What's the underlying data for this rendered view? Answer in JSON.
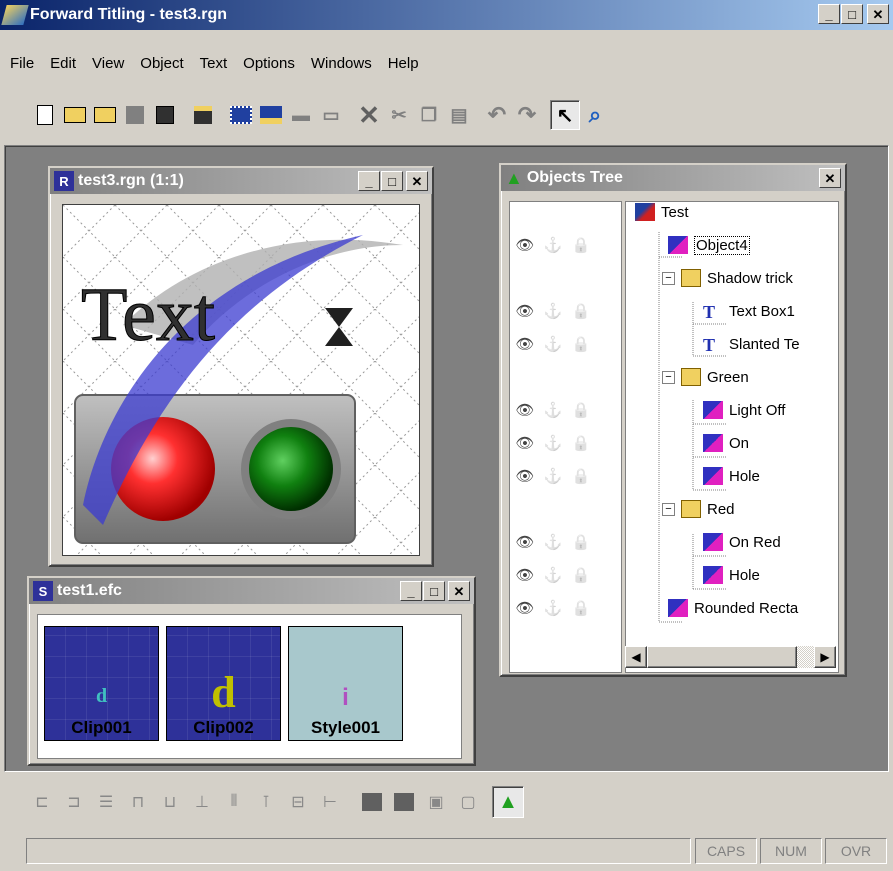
{
  "app": {
    "title": "Forward Titling - test3.rgn"
  },
  "caption_buttons": {
    "min": "_",
    "max": "□",
    "close": "✕"
  },
  "menu": [
    "File",
    "Edit",
    "View",
    "Object",
    "Text",
    "Options",
    "Windows",
    "Help"
  ],
  "doc_window": {
    "title": "test3.rgn  (1:1)",
    "canvas_text": "Text"
  },
  "clips_window": {
    "title": "test1.efc",
    "items": [
      {
        "glyph": "d",
        "label": "Clip001"
      },
      {
        "glyph": "d",
        "label": "Clip002"
      },
      {
        "glyph": "i",
        "label": "Style001"
      }
    ]
  },
  "tree_window": {
    "title": "Objects Tree",
    "items": [
      {
        "label": "Test",
        "depth": 0
      },
      {
        "label": "Object4",
        "depth": 1
      },
      {
        "label": "Shadow trick",
        "depth": 1,
        "expander": "−"
      },
      {
        "label": "Text Box1",
        "depth": 2
      },
      {
        "label": "Slanted Te",
        "depth": 2
      },
      {
        "label": "Green",
        "depth": 1,
        "expander": "−"
      },
      {
        "label": "Light Off",
        "depth": 2
      },
      {
        "label": "On",
        "depth": 2
      },
      {
        "label": "Hole",
        "depth": 2
      },
      {
        "label": "Red",
        "depth": 1,
        "expander": "−"
      },
      {
        "label": "On Red",
        "depth": 2
      },
      {
        "label": "Hole",
        "depth": 2
      },
      {
        "label": "Rounded Recta",
        "depth": 1
      }
    ]
  },
  "status": {
    "caps": "CAPS",
    "num": "NUM",
    "ovr": "OVR"
  },
  "colors": {
    "title_active": "#0a246a",
    "title_inactive": "#808080",
    "clip_bg": "#2e3199",
    "style_bg": "#a8c8cc"
  }
}
